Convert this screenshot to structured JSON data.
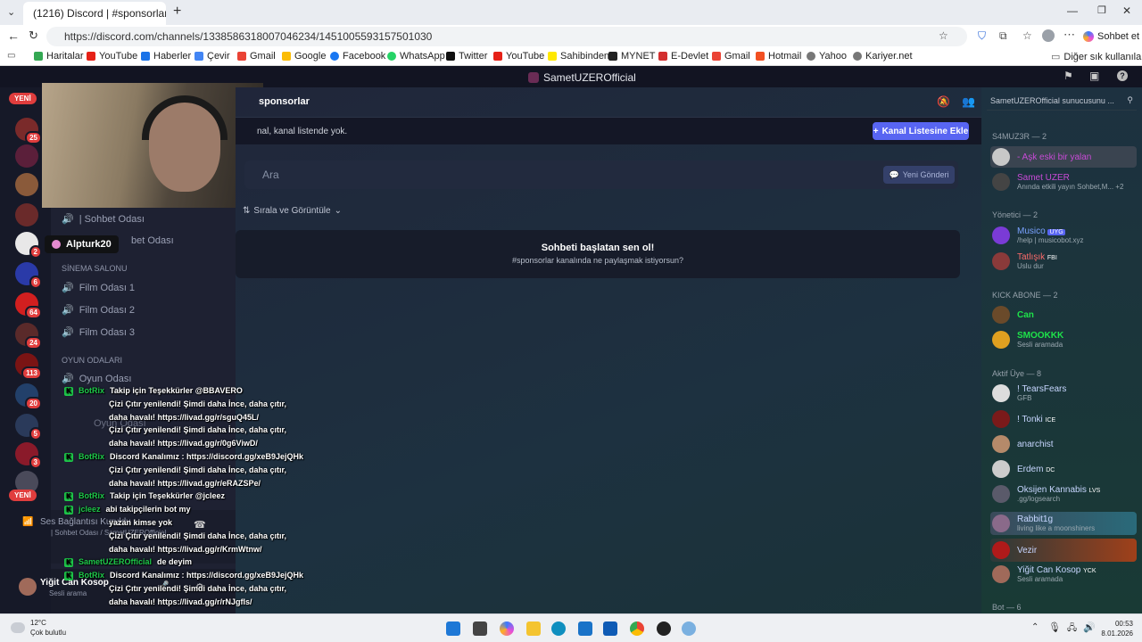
{
  "browser": {
    "tab_title": "(1216) Discord | #sponsorlar |",
    "url": "https://discord.com/channels/1338586318007046234/1451005593157501030",
    "chat_button": "Sohbet et",
    "bookmarks": [
      "Haritalar",
      "YouTube",
      "Haberler",
      "Çevir",
      "Gmail",
      "Google",
      "Facebook",
      "WhatsApp",
      "Twitter",
      "YouTube",
      "Sahibinden",
      "MYNET",
      "E-Devlet",
      "Gmail",
      "Hotmail",
      "Yahoo",
      "Kariyer.net"
    ],
    "bookmarks_other": "Diğer sık kullanılanlar"
  },
  "discord": {
    "server_title": "SametUZEROfficial",
    "guild_badges": {
      "new": "YENİ",
      "b1": "25",
      "b2": "2",
      "b3": "6",
      "b4": "64",
      "b5": "24",
      "b6": "113",
      "b7": "20",
      "b8": "5",
      "b9": "3"
    },
    "tooltip": "Alpturk20",
    "channels": {
      "sohbet1": "| Sohbet Odası",
      "sohbet2": "bet Odası",
      "cat_sinema": "SİNEMA SALONU",
      "film1": "Film Odası 1",
      "film2": "Film Odası 2",
      "film3": "Film Odası 3",
      "cat_oyun": "OYUN ODALARI",
      "oyun1": "Oyun Odası",
      "oyun2": "Oyun Odası"
    },
    "voice": {
      "status": "Ses Bağlantısı Kuruldu",
      "sub": "| Sohbet Odası / SametUZEROfficial"
    },
    "user": {
      "name": "Yiğit Can Kosop",
      "status": "Sesli arama"
    },
    "main": {
      "channel_name": "sponsorlar",
      "notice": "nal, kanal listende yok.",
      "add_button": "Kanal Listesine Ekle",
      "search_placeholder": "Ara",
      "new_post": "Yeni Gönderi",
      "sort": "Sırala ve Görüntüle",
      "empty_title": "Sohbeti başlatan sen ol!",
      "empty_sub": "#sponsorlar kanalında ne paylaşmak istiyorsun?"
    },
    "members": {
      "search": "SametUZEROfficial sunucusunu ...",
      "sections": [
        {
          "title": "S4MUZ3R — 2"
        },
        {
          "title": "Yönetici — 2"
        },
        {
          "title": "KICK ABONE — 2"
        },
        {
          "title": "Aktif Üye — 8"
        },
        {
          "title": "Bot — 6"
        }
      ],
      "list": [
        {
          "name": "- Aşk eski bir yalan",
          "sub": "",
          "color": "#c84ad6"
        },
        {
          "name": "Samet UZER",
          "sub": "Anında etkili yayın Sohbet,M...  +2",
          "color": "#c84ad6"
        },
        {
          "name": "Musico",
          "sub": "/help | musicobot.xyz",
          "color": "#7aa2ff",
          "tag": "UYG"
        },
        {
          "name": "Tatlışık",
          "sub": "Uslu dur",
          "color": "#ff6b6b",
          "tag": "FBI"
        },
        {
          "name": "Can",
          "sub": "",
          "color": "#1ee34a"
        },
        {
          "name": "SMOOKKK",
          "sub": "Sesli aramada",
          "color": "#1ee34a"
        },
        {
          "name": "! TearsFears",
          "sub": "GFB",
          "color": "#c7d6ff"
        },
        {
          "name": "! Tonki",
          "sub": "",
          "color": "#c7d6ff",
          "tag": "ICE"
        },
        {
          "name": "anarchist",
          "sub": "",
          "color": "#c7d6ff"
        },
        {
          "name": "Erdem",
          "sub": "",
          "color": "#c7d6ff",
          "tag": "DC"
        },
        {
          "name": "Oksijen Kannabis",
          "sub": ".gg/logsearch",
          "color": "#c7d6ff",
          "tag": "LVS"
        },
        {
          "name": "Rabbit1g",
          "sub": "living like a moonshiners",
          "color": "#c7d6ff"
        },
        {
          "name": "Vezir",
          "sub": "",
          "color": "#c7d6ff"
        },
        {
          "name": "Yiğit Can Kosop",
          "sub": "Sesli aramada",
          "color": "#c7d6ff",
          "tag": "YCK"
        }
      ]
    }
  },
  "chat_overlay": [
    {
      "user": "BotRix",
      "text": "Takip için Teşekkürler @BBAVERO"
    },
    {
      "user": "",
      "text": "Çizi Çıtır yenilendi! Şimdi daha İnce, daha çıtır,"
    },
    {
      "user": "",
      "text": "daha havalı! https://livad.gg/r/sguQ45L/"
    },
    {
      "user": "",
      "text": "Çizi Çıtır yenilendi! Şimdi daha İnce, daha çıtır,"
    },
    {
      "user": "",
      "text": "daha havalı! https://livad.gg/r/0g6ViwD/"
    },
    {
      "user": "BotRix",
      "text": "Discord Kanalımız : https://discord.gg/xeB9JejQHk"
    },
    {
      "user": "",
      "text": "Çizi Çıtır yenilendi! Şimdi daha İnce, daha çıtır,"
    },
    {
      "user": "",
      "text": "daha havalı! https://livad.gg/r/eRAZSPe/"
    },
    {
      "user": "BotRix",
      "text": "Takip için Teşekkürler @jcleez"
    },
    {
      "user": "jcleez",
      "text": "abi takipçilerin bot my"
    },
    {
      "user": "",
      "text": "yazan kimse yok"
    },
    {
      "user": "",
      "text": "Çizi Çıtır yenilendi! Şimdi daha İnce, daha çıtır,"
    },
    {
      "user": "",
      "text": "daha havalı! https://livad.gg/r/KrmWtnw/"
    },
    {
      "user": "SametUZEROfficial",
      "text": "de deyim"
    },
    {
      "user": "BotRix",
      "text": "Discord Kanalımız : https://discord.gg/xeB9JejQHk"
    },
    {
      "user": "",
      "text": "Çizi Çıtır yenilendi! Şimdi daha İnce, daha çıtır,"
    },
    {
      "user": "",
      "text": "daha havalı! https://livad.gg/r/rNJgfIs/"
    }
  ],
  "taskbar": {
    "weather_temp": "12°C",
    "weather_desc": "Çok bulutlu",
    "time": "00:53",
    "date": "8.01.2026"
  },
  "colors": {
    "accent": "#5865f2",
    "kick": "#1ec94a"
  }
}
